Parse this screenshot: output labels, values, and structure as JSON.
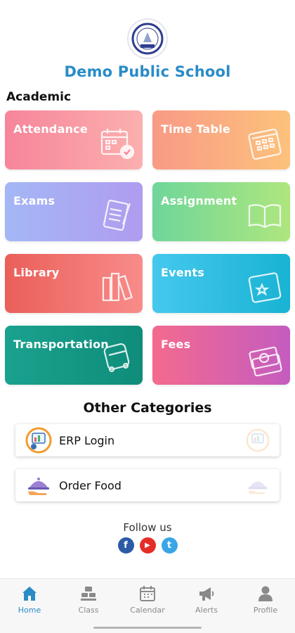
{
  "school": {
    "name": "Demo Public School"
  },
  "academic": {
    "title": "Academic",
    "tiles": [
      {
        "label": "Attendance",
        "icon": "calendar-check-icon"
      },
      {
        "label": "Time Table",
        "icon": "calendar-icon"
      },
      {
        "label": "Exams",
        "icon": "exam-paper-icon"
      },
      {
        "label": "Assignment",
        "icon": "open-book-icon"
      },
      {
        "label": "Library",
        "icon": "books-icon"
      },
      {
        "label": "Events",
        "icon": "event-calendar-icon"
      },
      {
        "label": "Transportation",
        "icon": "bus-icon"
      },
      {
        "label": "Fees",
        "icon": "money-icon"
      }
    ]
  },
  "other": {
    "title": "Other Categories",
    "items": [
      {
        "label": "ERP Login",
        "icon": "erp-chart-icon"
      },
      {
        "label": "Order Food",
        "icon": "food-cloche-icon"
      }
    ]
  },
  "follow": {
    "title": "Follow us",
    "facebook": "f",
    "youtube": "▶",
    "twitter": "t"
  },
  "nav": {
    "items": [
      {
        "label": "Home",
        "active": true
      },
      {
        "label": "Class"
      },
      {
        "label": "Calendar"
      },
      {
        "label": "Alerts"
      },
      {
        "label": "Profile"
      }
    ]
  },
  "colors": {
    "accent": "#2a8cc7",
    "nav_inactive": "#8a8a8a"
  }
}
